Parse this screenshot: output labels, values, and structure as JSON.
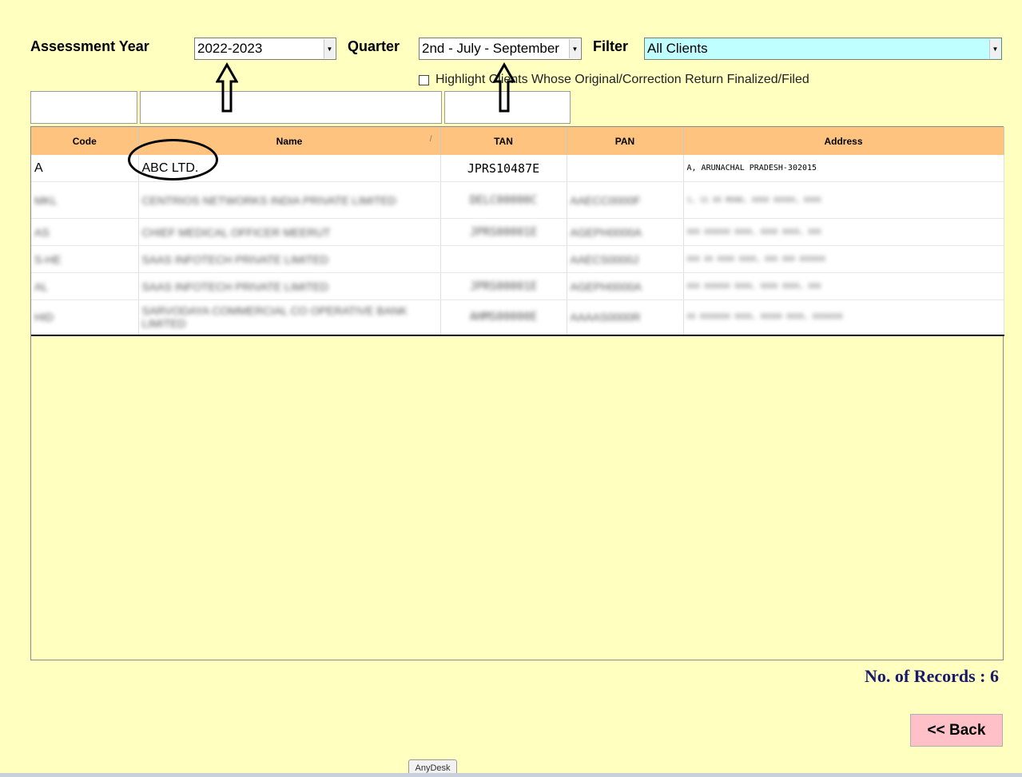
{
  "filters": {
    "assessment_year_label": "Assessment Year",
    "assessment_year_value": "2022-2023",
    "quarter_label": "Quarter",
    "quarter_value": "2nd - July - September",
    "filter_label": "Filter",
    "filter_value": "All Clients",
    "highlight_label": "Highlight Clients Whose Original/Correction Return Finalized/Filed"
  },
  "table": {
    "columns": [
      "Code",
      "Name",
      "TAN",
      "PAN",
      "Address"
    ],
    "rows": [
      {
        "code": "A",
        "name": "ABC LTD.",
        "tan": "JPRS10487E",
        "pan": "",
        "address": "A, ARUNACHAL PRADESH-302015"
      },
      {
        "code": "MKL",
        "name": "CENTRIOS NETWORKS INDIA PRIVATE LIMITED",
        "tan": "DELC00000C",
        "pan": "AAECC0000F",
        "address": "1, 11 XX ROAD, XXXX XXXXX, XXXX"
      },
      {
        "code": "AS",
        "name": "CHIEF MEDICAL OFFICER MEERUT",
        "tan": "JPRS00001E",
        "pan": "AGEPH0000A",
        "address": "XXX XXXXXX XXXX, XXXX XXXX, XXX"
      },
      {
        "code": "S-HE",
        "name": "SAAS INFOTECH PRIVATE LIMITED",
        "tan": "",
        "pan": "AAECS0000J",
        "address": "XXX XX XXXX XXXX, XXX XXX XXXXXX"
      },
      {
        "code": "AL",
        "name": "SAAS INFOTECH PRIVATE LIMITED",
        "tan": "JPRS00001E",
        "pan": "AGEPH0000A",
        "address": "XXX XXXXXX XXXX, XXXX XXXX, XXX"
      },
      {
        "code": "HID",
        "name": "SARVODAYA COMMERCIAL CO OPERATIVE BANK LIMITED",
        "tan": "AHMS00000E",
        "pan": "AAAAS0000R",
        "address": "XX XXXXXXX XXXX, XXXXX XXXX, XXXXXXX"
      }
    ]
  },
  "footer": {
    "records_text": "No. of Records : 6",
    "back_label": "<< Back",
    "anydesk_label": "AnyDesk"
  },
  "colors": {
    "background": "#ffffc0",
    "header": "#ffc380",
    "filter_combo": "#c0ffff",
    "back_button": "#ffc0c8",
    "records_text": "#1a1a6a"
  }
}
